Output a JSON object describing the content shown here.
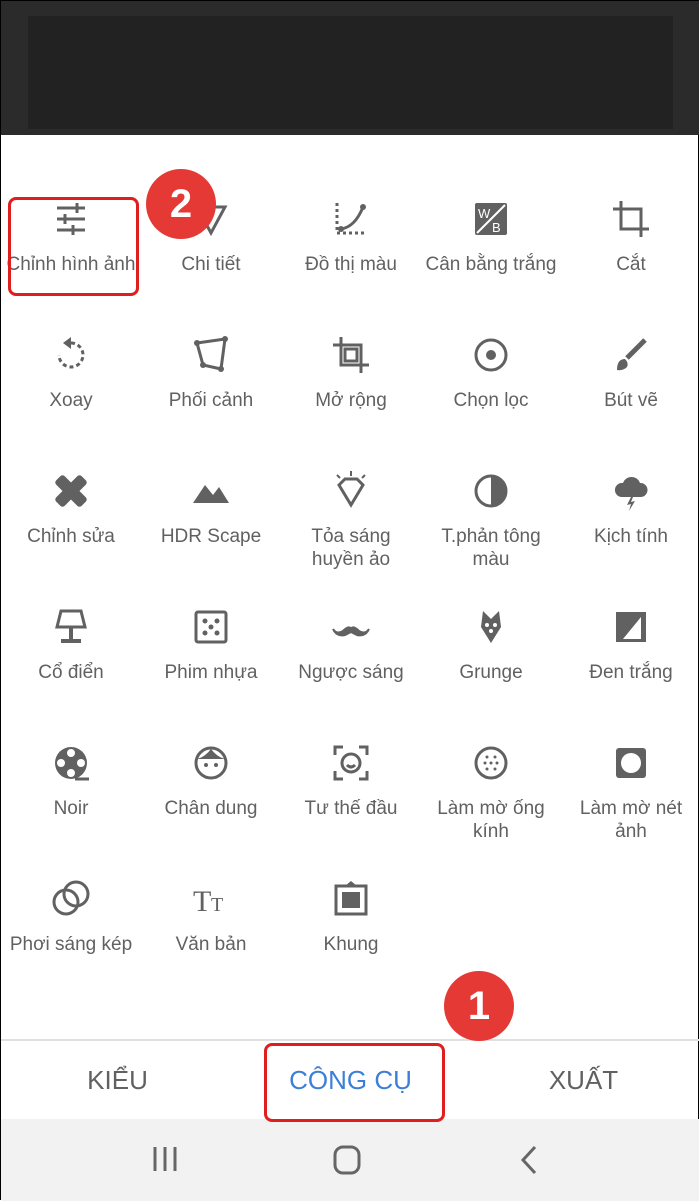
{
  "tools": [
    {
      "label": "Chỉnh hình ảnh",
      "icon": "tune-sliders-icon"
    },
    {
      "label": "Chi tiết",
      "icon": "details-triangle-icon"
    },
    {
      "label": "Đồ thị màu",
      "icon": "curves-icon"
    },
    {
      "label": "Cân bằng trắng",
      "icon": "white-balance-icon"
    },
    {
      "label": "Cắt",
      "icon": "crop-icon"
    },
    {
      "label": "Xoay",
      "icon": "rotate-icon"
    },
    {
      "label": "Phối cảnh",
      "icon": "perspective-icon"
    },
    {
      "label": "Mở rộng",
      "icon": "expand-icon"
    },
    {
      "label": "Chọn lọc",
      "icon": "selective-icon"
    },
    {
      "label": "Bút vẽ",
      "icon": "brush-icon"
    },
    {
      "label": "Chỉnh sửa",
      "icon": "healing-icon"
    },
    {
      "label": "HDR Scape",
      "icon": "mountains-icon"
    },
    {
      "label": "Tỏa sáng huyền ảo",
      "icon": "glamour-glow-icon"
    },
    {
      "label": "T.phản tông màu",
      "icon": "tonal-contrast-icon"
    },
    {
      "label": "Kịch tính",
      "icon": "drama-cloud-icon"
    },
    {
      "label": "Cổ điển",
      "icon": "vintage-lamp-icon"
    },
    {
      "label": "Phim nhựa",
      "icon": "grainy-film-icon"
    },
    {
      "label": "Ngược sáng",
      "icon": "mustache-icon"
    },
    {
      "label": "Grunge",
      "icon": "grunge-guitar-icon"
    },
    {
      "label": "Đen trắng",
      "icon": "black-white-icon"
    },
    {
      "label": "Noir",
      "icon": "film-reel-icon"
    },
    {
      "label": "Chân dung",
      "icon": "face-icon"
    },
    {
      "label": "Tư thế đầu",
      "icon": "head-pose-icon"
    },
    {
      "label": "Làm mờ ống kính",
      "icon": "lens-blur-icon"
    },
    {
      "label": "Làm mờ nét ảnh",
      "icon": "vignette-icon"
    },
    {
      "label": "Phơi sáng kép",
      "icon": "double-exposure-icon"
    },
    {
      "label": "Văn bản",
      "icon": "text-icon"
    },
    {
      "label": "Khung",
      "icon": "frame-icon"
    }
  ],
  "tabs": [
    {
      "label": "KIỂU"
    },
    {
      "label": "CÔNG CỤ",
      "active": true
    },
    {
      "label": "XUẤT"
    }
  ],
  "annotations": {
    "badge1": "1",
    "badge2": "2"
  },
  "colors": {
    "accent": "#3c7fd6",
    "icon": "#616161",
    "highlight": "#e01e1e"
  }
}
